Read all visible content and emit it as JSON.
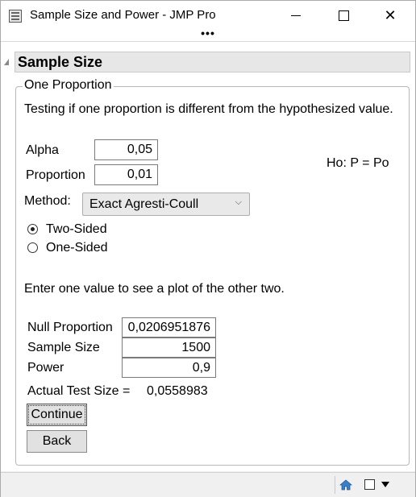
{
  "window": {
    "title": "Sample Size and Power - JMP Pro",
    "menu_dots": "•••",
    "minimize": "minimize",
    "maximize": "maximize",
    "close": "✕"
  },
  "outline": {
    "header": "Sample Size"
  },
  "panel": {
    "group_label": "One Proportion",
    "description": "Testing if one proportion is different from the hypothesized value.",
    "alpha_label": "Alpha",
    "alpha_value": "0,05",
    "proportion_label": "Proportion",
    "proportion_value": "0,01",
    "hypothesis": "Ho: P = Po",
    "method_label": "Method:",
    "method_selected": "Exact Agresti-Coull",
    "sides": [
      {
        "label": "Two-Sided",
        "selected": true
      },
      {
        "label": "One-Sided",
        "selected": false
      }
    ],
    "instruction": "Enter one value to see a plot of the other two.",
    "null_proportion_label": "Null Proportion",
    "null_proportion_value": "0,0206951876",
    "sample_size_label": "Sample Size",
    "sample_size_value": "1500",
    "power_label": "Power",
    "power_value": "0,9",
    "actual_test_size_label": "Actual Test Size =",
    "actual_test_size_value": "0,0558983",
    "continue_label": "Continue",
    "back_label": "Back"
  },
  "statusbar": {
    "icons": [
      "home-icon",
      "square-icon",
      "dropdown-arrow-icon"
    ]
  }
}
